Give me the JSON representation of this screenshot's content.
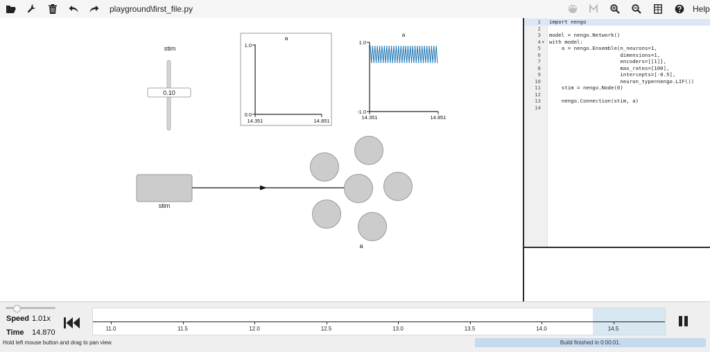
{
  "toolbar": {
    "filename": "playground\\first_file.py",
    "help_label": "Help",
    "icons": [
      "open-folder-icon",
      "wrench-icon",
      "trash-icon",
      "undo-icon",
      "redo-icon",
      "sync-icon",
      "graph-icon",
      "zoom-in-icon",
      "zoom-out-icon",
      "editor-toggle-icon",
      "help-icon"
    ]
  },
  "network": {
    "stim_slider": {
      "label": "stim",
      "value": "0.10"
    },
    "plot_a_boxed": {
      "title": "a",
      "ymax": "1.0",
      "ymin": "0.0",
      "xmin": "14.351",
      "xmax": "14.851"
    },
    "plot_a_spikes": {
      "title": "a",
      "ymax": "1.0",
      "ymin": "-1.0",
      "xmin": "14.351",
      "xmax": "14.851"
    },
    "node_label": "stim",
    "ensemble_label": "a"
  },
  "chart_data": [
    {
      "type": "line",
      "title": "a",
      "xlabel": "",
      "ylabel": "",
      "xlim": [
        14.351,
        14.851
      ],
      "ylim": [
        0.0,
        1.0
      ],
      "series": []
    },
    {
      "type": "line",
      "title": "a",
      "xlabel": "",
      "ylabel": "",
      "xlim": [
        14.351,
        14.851
      ],
      "ylim": [
        -1.0,
        1.0
      ],
      "series": [
        {
          "values_range": [
            0.4,
            0.9
          ]
        }
      ],
      "colors": [
        "#1f77b4"
      ]
    }
  ],
  "editor": {
    "lines": [
      {
        "n": "1",
        "fold": "",
        "code": "import nengo"
      },
      {
        "n": "2",
        "fold": "",
        "code": ""
      },
      {
        "n": "3",
        "fold": "",
        "code": "model = nengo.Network()"
      },
      {
        "n": "4",
        "fold": "▾",
        "code": "with model:"
      },
      {
        "n": "5",
        "fold": "",
        "code": "    a = nengo.Ensemble(n_neurons=1,"
      },
      {
        "n": "6",
        "fold": "",
        "code": "                       dimensions=1,"
      },
      {
        "n": "7",
        "fold": "",
        "code": "                       encoders=[[1]],"
      },
      {
        "n": "8",
        "fold": "",
        "code": "                       max_rates=[100],"
      },
      {
        "n": "9",
        "fold": "",
        "code": "                       intercepts=[-0.5],"
      },
      {
        "n": "10",
        "fold": "",
        "code": "                       neuron_type=nengo.LIF())"
      },
      {
        "n": "11",
        "fold": "",
        "code": "    stim = nengo.Node(0)"
      },
      {
        "n": "12",
        "fold": "",
        "code": ""
      },
      {
        "n": "13",
        "fold": "",
        "code": "    nengo.Connection(stim, a)"
      },
      {
        "n": "14",
        "fold": "",
        "code": ""
      }
    ]
  },
  "sim": {
    "speed_label": "Speed",
    "speed_value": "1.01x",
    "time_label": "Time",
    "time_value": "14.870",
    "timeline_ticks": [
      "11.0",
      "11.5",
      "12.0",
      "12.5",
      "13.0",
      "13.5",
      "14.0",
      "14.5"
    ],
    "status_left": "Hold left mouse button and drag to pan view.",
    "status_right": "Build finished in 0:00:01."
  },
  "colors": {
    "spike_line": "#1f77b4",
    "ensemble_fill": "#cccccc",
    "timeline_window": "#d8e8f2",
    "status_bar": "#c5d9ef"
  }
}
